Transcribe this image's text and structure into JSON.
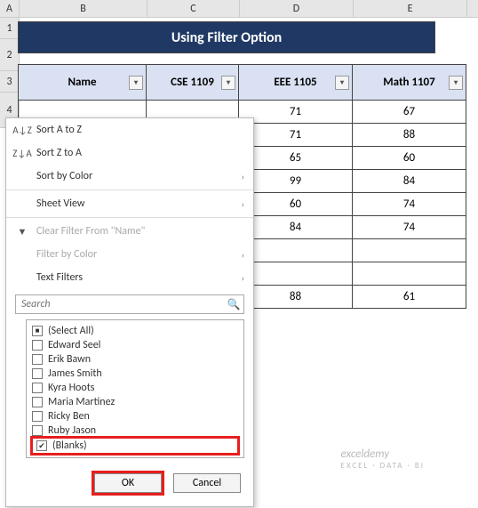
{
  "columns": {
    "A": "A",
    "B": "B",
    "C": "C",
    "D": "D",
    "E": "E"
  },
  "rows": {
    "r1": "1",
    "r2": "2",
    "r3": "3",
    "r4": "4"
  },
  "title": "Using Filter Option",
  "headers": {
    "name": "Name",
    "cse": "CSE 1109",
    "eee": "EEE 1105",
    "math": "Math 1107"
  },
  "data_rows": {
    "r0": {
      "eee": "71",
      "math": "67"
    },
    "r1": {
      "eee": "71",
      "math": "88"
    },
    "r2": {
      "eee": "65",
      "math": "60"
    },
    "r3": {
      "eee": "99",
      "math": "84"
    },
    "r4": {
      "eee": "60",
      "math": "74"
    },
    "r5": {
      "eee": "84",
      "math": "74"
    },
    "r6": {
      "eee": "",
      "math": ""
    },
    "r7": {
      "eee": "",
      "math": ""
    },
    "r8": {
      "eee": "88",
      "math": "61"
    }
  },
  "menu": {
    "sort_az": "Sort A to Z",
    "sort_za": "Sort Z to A",
    "sort_color": "Sort by Color",
    "sheet_view": "Sheet View",
    "clear": "Clear Filter From \"Name\"",
    "filter_color": "Filter by Color",
    "text_filters": "Text Filters",
    "search_ph": "Search",
    "items": {
      "i0": "(Select All)",
      "i1": "Edward Seel",
      "i2": "Erik Bawn",
      "i3": "James Smith",
      "i4": "Kyra Hoots",
      "i5": "Maria Martinez",
      "i6": "Ricky Ben",
      "i7": "Ruby Jason",
      "i8": "(Blanks)"
    },
    "ok": "OK",
    "cancel": "Cancel"
  },
  "watermark": {
    "main": "exceldemy",
    "sub": "EXCEL · DATA · BI"
  },
  "icons": {
    "az": "A↓Z",
    "za": "Z↓A",
    "funnel": "▼",
    "dd": "▾",
    "arr": "›",
    "search": "🔍"
  }
}
